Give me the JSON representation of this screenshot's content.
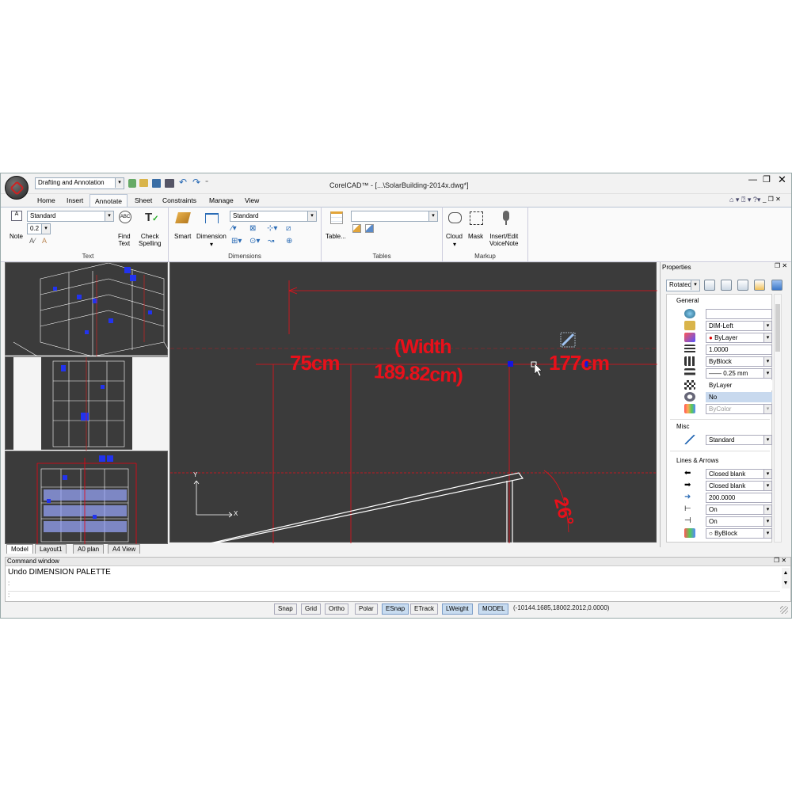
{
  "window": {
    "title": "CorelCAD™ - [...\\SolarBuilding-2014x.dwg*]",
    "workspace": "Drafting and Annotation"
  },
  "menu": {
    "tabs": [
      "Home",
      "Insert",
      "Annotate",
      "Sheet",
      "Constraints",
      "Manage",
      "View"
    ],
    "active_tab": "Annotate"
  },
  "ribbon": {
    "text": {
      "style": "Standard",
      "height": "0.2",
      "note_label": "Note",
      "find_text_label": "Find\nText",
      "check_spelling_label": "Check\nSpelling",
      "group_label": "Text"
    },
    "dimensions": {
      "style": "Standard",
      "smart_label": "Smart",
      "dimension_label": "Dimension",
      "group_label": "Dimensions"
    },
    "tables": {
      "style": "",
      "table_label": "Table...",
      "group_label": "Tables"
    },
    "markup": {
      "cloud_label": "Cloud",
      "mask_label": "Mask",
      "voicenote_label": "Insert/Edit\nVoiceNote",
      "group_label": "Markup"
    }
  },
  "layout_tabs": [
    "Model",
    "Layout1",
    "A0 plan",
    "A4 View"
  ],
  "drawing": {
    "dim_text_1": "75cm",
    "dim_text_2a": "(Width",
    "dim_text_2b": "189.82cm)",
    "dim_text_3": "177cm",
    "angle_text": "26°",
    "ucs_y": "Y",
    "ucs_x": "X",
    "colors": {
      "background": "#3b3b3b",
      "dimension": "#e8101a",
      "geometry": "#ffffff",
      "grip": "#1010d0"
    }
  },
  "properties": {
    "title": "Properties",
    "selector": "Rotated",
    "sections": {
      "general": "General",
      "misc": "Misc",
      "lines_arrows": "Lines & Arrows"
    },
    "general": {
      "blank": "",
      "layer": "DIM-Left",
      "color": "ByLayer",
      "scale": "1.0000",
      "linestyle": "ByBlock",
      "lineweight": "—— 0.25 mm",
      "transparency": "ByLayer",
      "hyperlink": "No",
      "plotstyle": "ByColor"
    },
    "misc": {
      "dim_style": "Standard"
    },
    "lines_arrows": {
      "arrow1": "Closed blank",
      "arrow2": "Closed blank",
      "arrow_size": "200.0000",
      "ext1": "On",
      "ext2": "On",
      "dimline_color": "ByBlock"
    }
  },
  "command": {
    "title": "Command window",
    "history": "Undo DIMENSION PALETTE",
    "prompt1": ":",
    "prompt2": ":"
  },
  "status": {
    "buttons": [
      "Snap",
      "Grid",
      "Ortho",
      "Polar",
      "ESnap",
      "ETrack",
      "LWeight",
      "MODEL"
    ],
    "active": [
      "ESnap",
      "LWeight",
      "MODEL"
    ],
    "coords": "(-10144.1685,18002.2012,0.0000)"
  }
}
